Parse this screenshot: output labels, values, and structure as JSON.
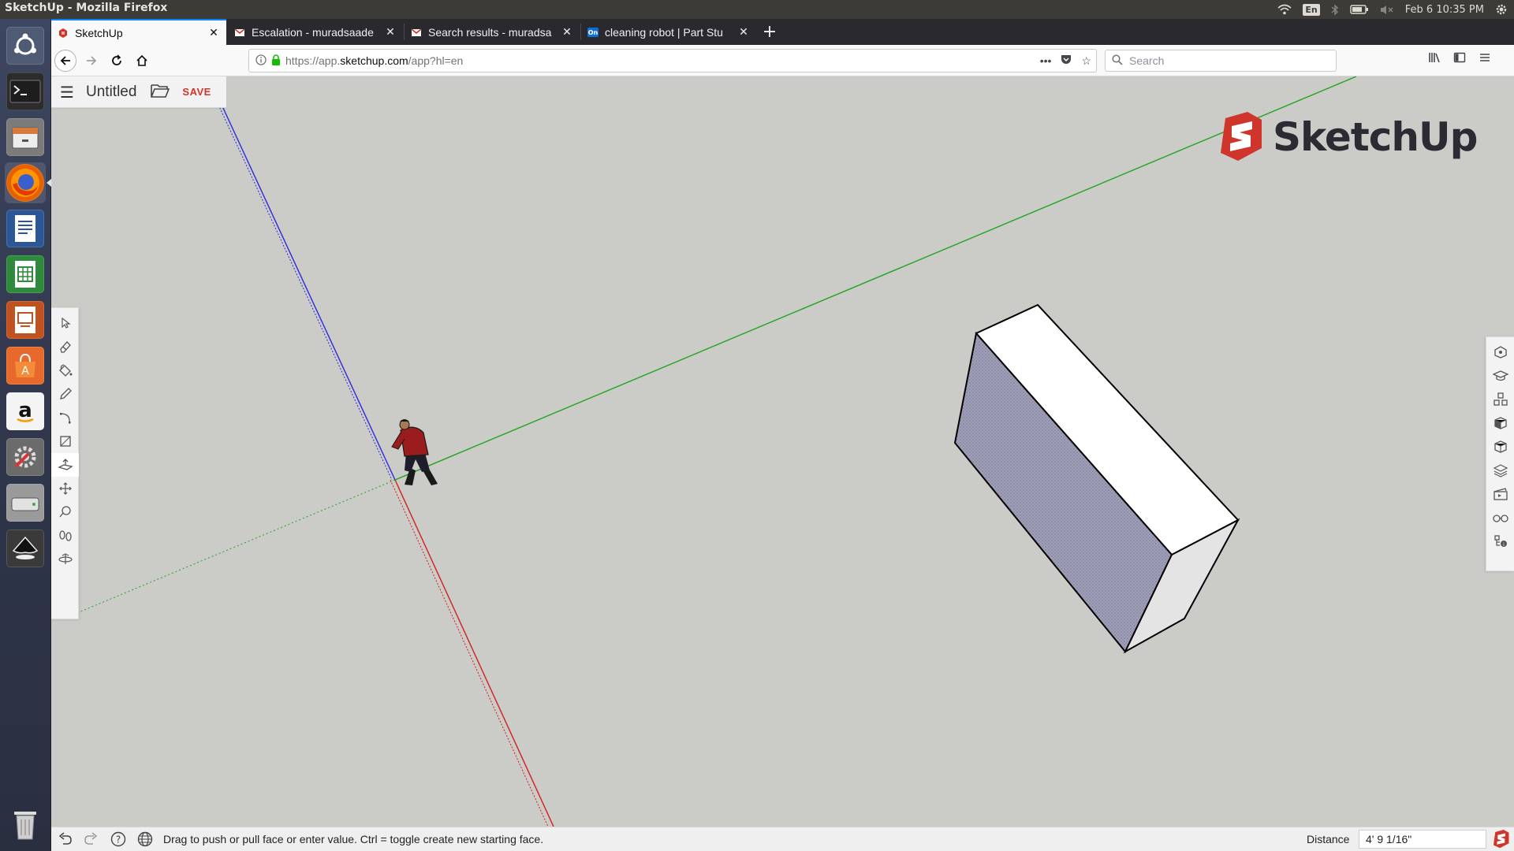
{
  "os": {
    "window_title": "SketchUp - Mozilla Firefox",
    "keyboard_layout": "En",
    "clock": "Feb 6 10:35 PM"
  },
  "browser": {
    "tabs": [
      {
        "label": "SketchUp",
        "active": true,
        "favicon": "sketchup-favicon"
      },
      {
        "label": "Escalation - muradsaade",
        "active": false,
        "favicon": "gmail-favicon"
      },
      {
        "label": "Search results - muradsa",
        "active": false,
        "favicon": "gmail-favicon"
      },
      {
        "label": "cleaning robot | Part Stu",
        "active": false,
        "favicon": "onshape-favicon"
      }
    ],
    "new_tab": "+",
    "url_prefix": "https://app.",
    "url_domain": "sketchup.com",
    "url_path": "/app?hl=en",
    "search_placeholder": "Search"
  },
  "app": {
    "document_title": "Untitled",
    "save_label": "SAVE",
    "logo_text": "SketchUp",
    "accent_color": "#d0352c",
    "status_hint": "Drag to push or pull face or enter value. Ctrl = toggle create new starting face.",
    "measure_label": "Distance",
    "measure_value": "4' 9 1/16\"",
    "active_tool": "push-pull",
    "tools": [
      "select",
      "eraser",
      "paint-bucket",
      "pencil",
      "arc",
      "rectangle",
      "push-pull",
      "move",
      "tape-measure",
      "walk",
      "orbit"
    ],
    "panel_buttons": [
      "entity-info",
      "instructor",
      "components",
      "materials",
      "styles",
      "layers",
      "scenes",
      "display",
      "outliner"
    ]
  },
  "axis_colors": {
    "red": "#d11f1f",
    "green": "#1fa51f",
    "blue": "#1f1fd1"
  }
}
